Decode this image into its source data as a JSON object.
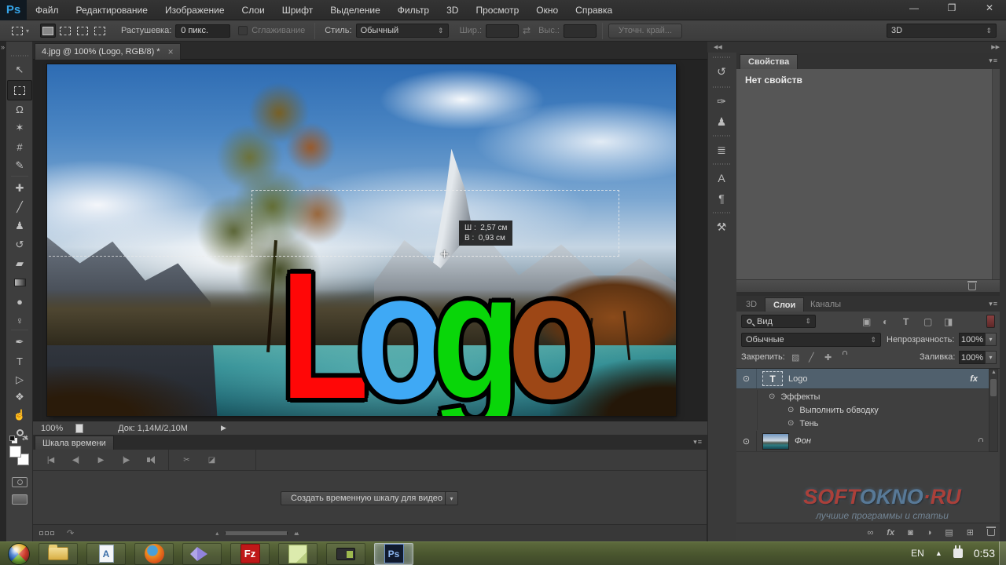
{
  "window": {
    "minimize_glyph": "—",
    "restore_glyph": "❐",
    "close_glyph": "✕"
  },
  "icons": {
    "spinner": "⇕",
    "dropdown": "▾",
    "panel_menu": "▾≡",
    "swap_arrows": "⇄",
    "status_proof": "▶",
    "collapse_left": "◀◀",
    "collapse_right": "▶▶",
    "toolbar_collapse": "»",
    "hidden_icons": "▲",
    "flowline_arrow": "↷",
    "zoom_out_hill": "▴",
    "zoom_in_hill": "▴▴",
    "eye": "⊙"
  },
  "menubar": {
    "logo": "Ps",
    "items": [
      "Файл",
      "Редактирование",
      "Изображение",
      "Слои",
      "Шрифт",
      "Выделение",
      "Фильтр",
      "3D",
      "Просмотр",
      "Окно",
      "Справка"
    ]
  },
  "options_bar": {
    "feather_label": "Растушевка:",
    "feather_value": "0 пикс.",
    "antialias_label": "Сглаживание",
    "style_label": "Стиль:",
    "style_value": "Обычный",
    "width_label": "Шир.:",
    "height_label": "Выс.:",
    "refine_edge_label": "Уточн. край...",
    "workspace_value": "3D"
  },
  "toolbar": {
    "tools": [
      {
        "id": "move-tool",
        "glyph": "↖"
      },
      {
        "id": "rectangular-marquee-tool",
        "glyph": ""
      },
      {
        "id": "lasso-tool",
        "glyph": "Ω"
      },
      {
        "id": "magic-wand-tool",
        "glyph": "✶"
      },
      {
        "id": "crop-tool",
        "glyph": "#"
      },
      {
        "id": "eyedropper-tool",
        "glyph": "✎"
      },
      {
        "id": "healing-brush-tool",
        "glyph": "✚"
      },
      {
        "id": "brush-tool",
        "glyph": "╱"
      },
      {
        "id": "clone-stamp-tool",
        "glyph": "♟"
      },
      {
        "id": "history-brush-tool",
        "glyph": "↺"
      },
      {
        "id": "eraser-tool",
        "glyph": "▰"
      },
      {
        "id": "gradient-tool",
        "glyph": ""
      },
      {
        "id": "blur-tool",
        "glyph": "●"
      },
      {
        "id": "dodge-tool",
        "glyph": "♀"
      },
      {
        "id": "pen-tool",
        "glyph": "✒"
      },
      {
        "id": "type-tool",
        "glyph": "T"
      },
      {
        "id": "path-selection-tool",
        "glyph": "▷"
      },
      {
        "id": "custom-shape-tool",
        "glyph": "❖"
      },
      {
        "id": "hand-tool",
        "glyph": "☝"
      },
      {
        "id": "zoom-tool",
        "glyph": ""
      }
    ]
  },
  "dock_strip": {
    "icons": [
      {
        "id": "history-panel-icon",
        "glyph": "↺"
      },
      {
        "id": "brush-presets-panel-icon",
        "glyph": "✑"
      },
      {
        "id": "clone-source-panel-icon",
        "glyph": "♟"
      },
      {
        "id": "measurement-log-panel-icon",
        "glyph": "≣"
      },
      {
        "id": "character-panel-icon",
        "glyph": "A"
      },
      {
        "id": "paragraph-panel-icon",
        "glyph": "¶"
      },
      {
        "id": "tool-presets-panel-icon",
        "glyph": "⚒"
      }
    ]
  },
  "document": {
    "tab_title": "4.jpg @ 100% (Logo, RGB/8) *",
    "tab_close": "×",
    "logo_letters": [
      {
        "char": "L",
        "color": "#ff0707"
      },
      {
        "char": "o",
        "color": "#3fa9f5"
      },
      {
        "char": "g",
        "color": "#09d609"
      },
      {
        "char": "o",
        "color": "#9d4716"
      }
    ],
    "size_tooltip": {
      "width_label": "Ш :",
      "width_value": "2,57 см",
      "height_label": "В :",
      "height_value": "0,93 см"
    },
    "crosshair": "+",
    "status_bar": {
      "zoom_value": "100%",
      "doc_info": "Док: 1,14М/2,10М"
    }
  },
  "properties_panel": {
    "tab_label": "Свойства",
    "empty_text": "Нет свойств"
  },
  "layers_panel": {
    "tabs": [
      "3D",
      "Слои",
      "Каналы"
    ],
    "kind_filter_value": "Вид",
    "blend_mode_value": "Обычные",
    "opacity_label": "Непрозрачность:",
    "opacity_value": "100%",
    "lock_label": "Закрепить:",
    "fill_label": "Заливка:",
    "fill_value": "100%",
    "filter_icons": [
      {
        "id": "filter-pixel-layers-icon",
        "glyph": "▣"
      },
      {
        "id": "filter-adjustment-layers-icon",
        "glyph": "◐"
      },
      {
        "id": "filter-type-layers-icon",
        "glyph": "T"
      },
      {
        "id": "filter-shape-layers-icon",
        "glyph": "▢"
      },
      {
        "id": "filter-smart-objects-icon",
        "glyph": "◨"
      }
    ],
    "rows": [
      {
        "name": "Logo",
        "thumb": "T",
        "badge": "fx"
      },
      {
        "name": "Эффекты"
      },
      {
        "name": "Выполнить обводку"
      },
      {
        "name": "Тень"
      },
      {
        "name": "Фон"
      }
    ]
  },
  "timeline_panel": {
    "tab_label": "Шкала времени",
    "transport": [
      "|◀",
      "◀|",
      "▶",
      "|▶"
    ],
    "scissors_glyph": "✂",
    "transition_glyph": "◪",
    "create_button_label": "Создать временную шкалу для видео"
  },
  "footer_icons": [
    {
      "id": "link-layers-icon",
      "glyph": "∞"
    },
    {
      "id": "layer-style-icon",
      "glyph": "fx"
    },
    {
      "id": "layer-mask-icon",
      "glyph": "◙"
    },
    {
      "id": "adjustment-layer-icon",
      "glyph": "◑"
    },
    {
      "id": "layer-group-icon",
      "glyph": "▤"
    },
    {
      "id": "new-layer-icon",
      "glyph": "⊞"
    }
  ],
  "watermark": {
    "line1_part1": "SOFT",
    "line1_part2": "OKNO",
    "line1_part3": "·RU",
    "line2": "лучшие программы и статьи"
  },
  "taskbar": {
    "language": "EN",
    "time": "0:53",
    "wordpad_label": "A",
    "filezilla_label": "Fz",
    "photoshop_label": "Ps"
  },
  "colors": {
    "accent_blue": "#35a4e8",
    "selected_layer_bg": "#50606d",
    "taskbar_green": "#49552e",
    "logo_red": "#ff0707",
    "logo_blue": "#3fa9f5",
    "logo_green": "#09d609",
    "logo_orange": "#9d4716"
  }
}
